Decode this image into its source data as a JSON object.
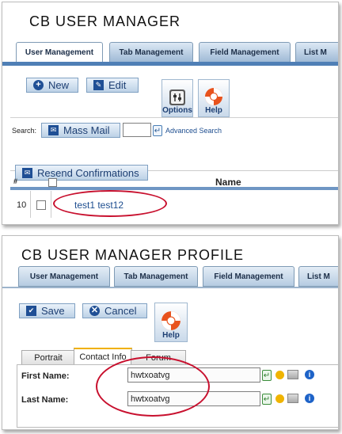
{
  "top": {
    "title": "CB USER MANAGER",
    "tabs": [
      "User Management",
      "Tab Management",
      "Field Management",
      "List M"
    ],
    "toolbar": {
      "new_label": "New",
      "edit_label": "Edit",
      "options_label": "Options",
      "help_label": "Help"
    },
    "search_label": "Search:",
    "mass_mail_label": "Mass Mail",
    "advanced_search_label": "Advanced Search",
    "resend_label": "Resend Confirmations",
    "column_number": "#",
    "column_name": "Name",
    "row": {
      "number": "10",
      "name": "test1 test12"
    }
  },
  "bottom": {
    "title": "CB USER MANAGER PROFILE",
    "tabs": [
      "User Management",
      "Tab Management",
      "Field Management",
      "List M"
    ],
    "toolbar": {
      "save_label": "Save",
      "cancel_label": "Cancel",
      "help_label": "Help"
    },
    "subtabs": [
      "Portrait",
      "Contact Info",
      "Forum"
    ],
    "fields": [
      {
        "label": "First Name:",
        "value": "hwtxoatvg"
      },
      {
        "label": "Last Name:",
        "value": "hwtxoatvg"
      }
    ]
  },
  "colors": {
    "highlight_ellipse": "#c8102e",
    "tab_bar": "#4f7fb6",
    "link": "#1d4d8f"
  },
  "icons": [
    "plus-circle-icon",
    "edit-icon",
    "options-icon",
    "lifebuoy-icon",
    "mail-icon",
    "advanced-search-icon",
    "check-circle-icon",
    "cancel-circle-icon"
  ]
}
